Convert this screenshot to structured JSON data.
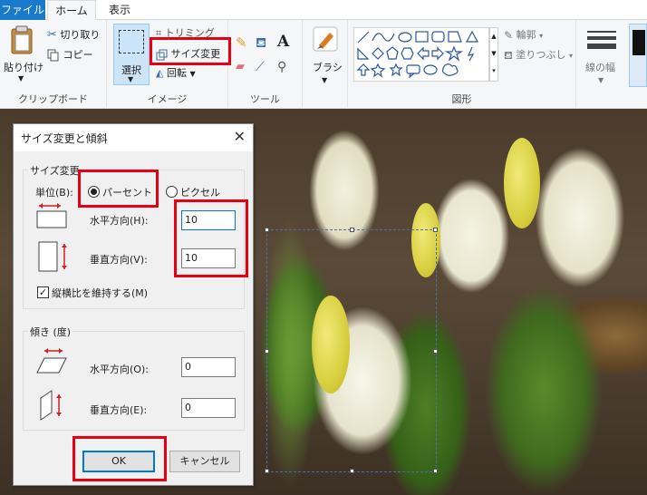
{
  "tabs": {
    "file": "ファイル",
    "home": "ホーム",
    "view": "表示"
  },
  "ribbon": {
    "clipboard": {
      "paste": "貼り付け",
      "cut": "切り取り",
      "copy": "コピー",
      "label": "クリップボード"
    },
    "image": {
      "select": "選択",
      "crop": "トリミング",
      "resize": "サイズ変更",
      "rotate": "回転",
      "label": "イメージ"
    },
    "tools": {
      "label": "ツール",
      "text_glyph": "A"
    },
    "brushes": {
      "label": "ブラシ"
    },
    "shapes": {
      "outline": "輪郭",
      "fill": "塗りつぶし",
      "label": "図形"
    },
    "size": {
      "label": "線の幅"
    }
  },
  "dialog": {
    "title": "サイズ変更と傾斜",
    "resize_group": "サイズ変更",
    "unit_label": "単位(B):",
    "percent": "パーセント",
    "pixel": "ピクセル",
    "horizontal_label": "水平方向(H):",
    "horizontal_value": "10",
    "vertical_label": "垂直方向(V):",
    "vertical_value": "10",
    "aspect_label": "縦横比を維持する(M)",
    "skew_group": "傾き (度)",
    "skew_h_label": "水平方向(O):",
    "skew_h_value": "0",
    "skew_v_label": "垂直方向(E):",
    "skew_v_value": "0",
    "ok": "OK",
    "cancel": "キャンセル"
  },
  "colors": {
    "accent": "#1979ca",
    "highlight": "#e60012",
    "focus": "#0078d7",
    "arrow_red": "#d32020"
  }
}
